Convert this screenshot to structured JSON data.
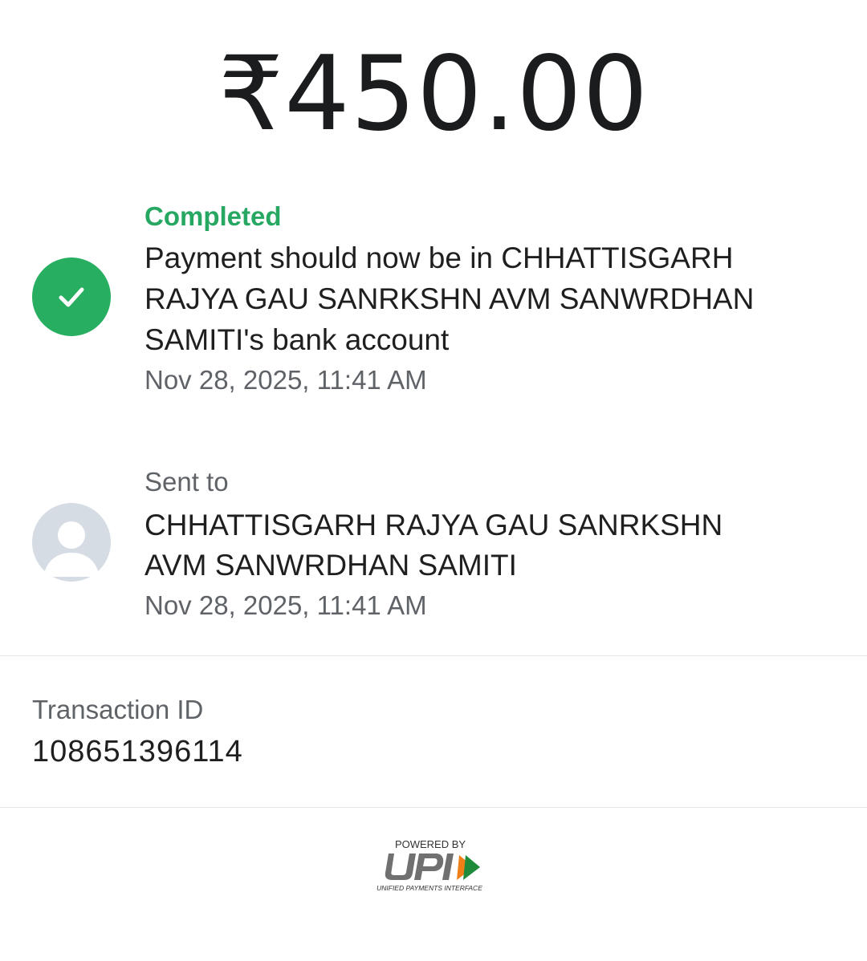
{
  "amount": "₹450.00",
  "status": {
    "label": "Completed",
    "message": "Payment should now be in CHHATTISGARH RAJYA GAU SANRKSHN AVM SANWRDHAN SAMITI's bank account",
    "timestamp": "Nov 28, 2025, 11:41 AM",
    "icon": "check-icon",
    "color": "#27ae60"
  },
  "recipient": {
    "label": "Sent to",
    "name": "CHHATTISGARH RAJYA GAU SANRKSHN AVM SANWRDHAN SAMITI",
    "timestamp": "Nov 28, 2025, 11:41 AM",
    "icon": "avatar-icon"
  },
  "transaction": {
    "label": "Transaction ID",
    "id": "108651396114"
  },
  "footer": {
    "powered_by": "POWERED BY",
    "upi_tagline": "UNIFIED PAYMENTS INTERFACE"
  }
}
